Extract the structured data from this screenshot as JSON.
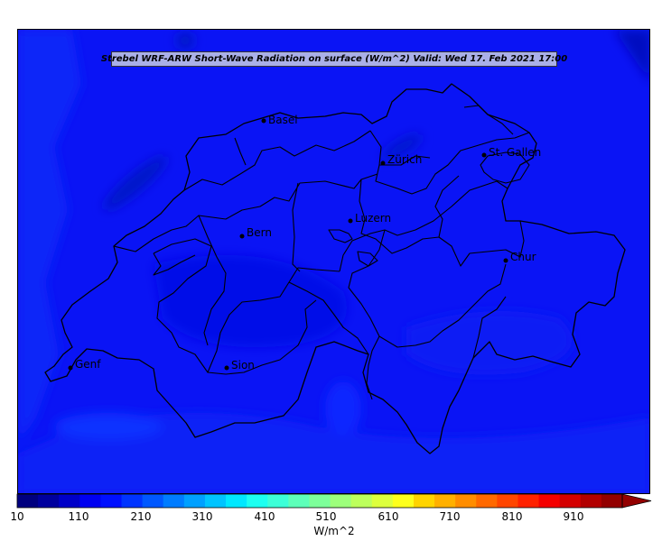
{
  "map": {
    "title": "Strebel WRF-ARW Short-Wave Radiation on surface (W/m^2)   Valid: Wed 17. Feb 2021 17:00",
    "background_color": "#0a14f5",
    "cities": [
      {
        "name": "Basel"
      },
      {
        "name": "Zürich"
      },
      {
        "name": "St. Gallen"
      },
      {
        "name": "Luzern"
      },
      {
        "name": "Bern"
      },
      {
        "name": "Chur"
      },
      {
        "name": "Genf"
      },
      {
        "name": "Sion"
      }
    ]
  },
  "colorbar": {
    "ticks": [
      "10",
      "110",
      "210",
      "310",
      "410",
      "510",
      "610",
      "710",
      "810",
      "910"
    ],
    "unit": "W/m^2",
    "colors": [
      "#00007f",
      "#00009e",
      "#0000c8",
      "#0000f1",
      "#0010ff",
      "#0034ff",
      "#0058ff",
      "#007cff",
      "#00a0ff",
      "#00c4ff",
      "#00e8ff",
      "#1cfff1",
      "#3cffd8",
      "#5dffb9",
      "#7dff9a",
      "#9dff7b",
      "#bdff5c",
      "#ddff3d",
      "#fdff1c",
      "#ffd400",
      "#ffb000",
      "#ff8d00",
      "#ff6900",
      "#ff4600",
      "#ff2200",
      "#f50000",
      "#d40000",
      "#b20000",
      "#930000"
    ]
  }
}
